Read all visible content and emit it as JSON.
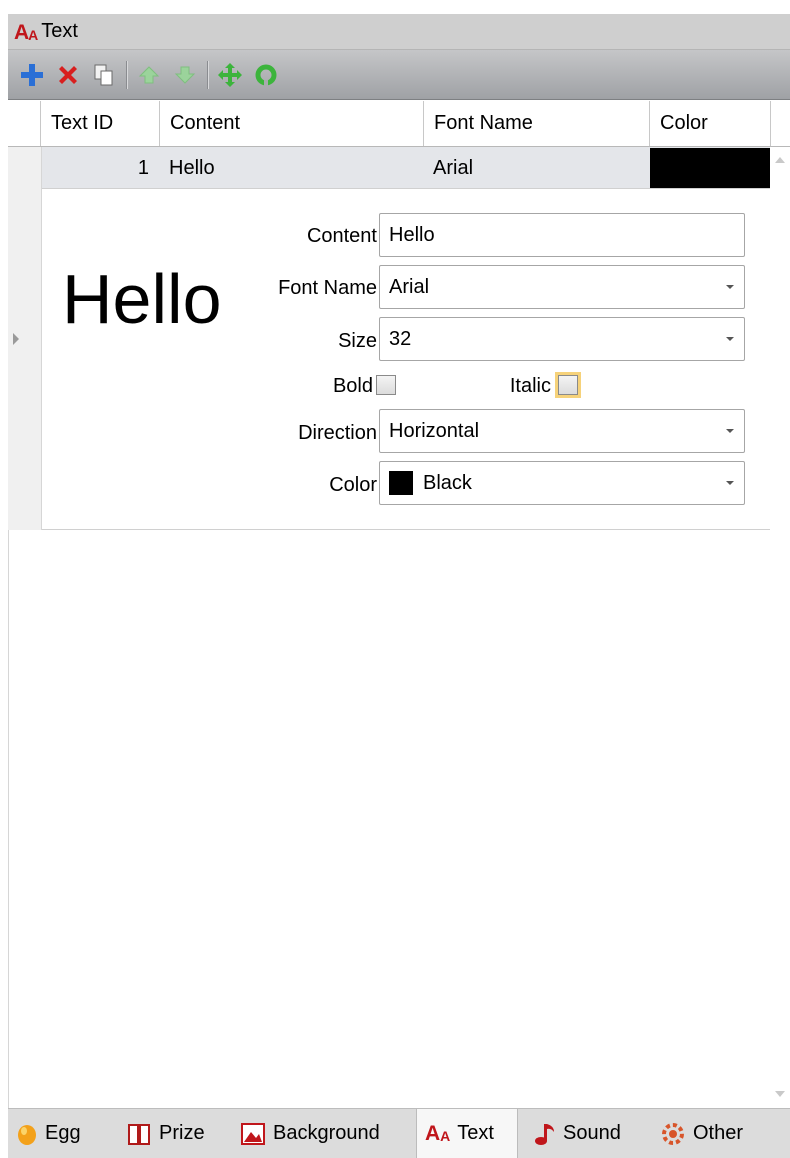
{
  "window": {
    "title": "Text"
  },
  "toolbar": {
    "buttons": [
      {
        "icon": "add-icon",
        "color": "#2a6fd6"
      },
      {
        "icon": "delete-icon",
        "color": "#d81f1f"
      },
      {
        "icon": "copy-icon",
        "color": "#666666"
      },
      {
        "icon": "move-up-icon",
        "color": "#8cc98c"
      },
      {
        "icon": "move-down-icon",
        "color": "#8cc98c"
      },
      {
        "icon": "move-icon",
        "color": "#3cb43c"
      },
      {
        "icon": "refresh-icon",
        "color": "#3cb43c"
      }
    ]
  },
  "grid": {
    "columns": [
      "Text ID",
      "Content",
      "Font Name",
      "Color"
    ],
    "rows": [
      {
        "text_id": "1",
        "content": "Hello",
        "font_name": "Arial",
        "color": "#000000"
      }
    ]
  },
  "details": {
    "preview_text": "Hello",
    "content_label": "Content",
    "content_value": "Hello",
    "font_name_label": "Font Name",
    "font_name_value": "Arial",
    "size_label": "Size",
    "size_value": "32",
    "bold_label": "Bold",
    "italic_label": "Italic",
    "direction_label": "Direction",
    "direction_value": "Horizontal",
    "color_label": "Color",
    "color_value": "Black",
    "color_swatch": "#000000"
  },
  "tabs": [
    {
      "label": "Egg",
      "icon": "egg-icon"
    },
    {
      "label": "Prize",
      "icon": "prize-icon"
    },
    {
      "label": "Background",
      "icon": "background-icon"
    },
    {
      "label": "Text",
      "icon": "text-icon",
      "active": true
    },
    {
      "label": "Sound",
      "icon": "sound-icon"
    },
    {
      "label": "Other",
      "icon": "other-icon"
    }
  ]
}
